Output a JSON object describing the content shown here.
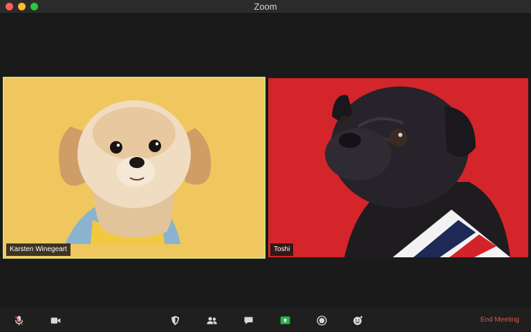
{
  "window": {
    "title": "Zoom"
  },
  "participants": [
    {
      "name": "Karsten Winegeart",
      "active_speaker": true
    },
    {
      "name": "Toshi",
      "active_speaker": false
    }
  ],
  "toolbar": {
    "icons": [
      "microphone-muted-icon",
      "video-camera-icon",
      "security-shield-icon",
      "participants-icon",
      "chat-icon",
      "share-screen-icon",
      "record-icon",
      "reactions-icon"
    ],
    "end_label": "End Meeting"
  },
  "colors": {
    "active_speaker_border": "#cde07a",
    "share_screen": "#2bb24c",
    "end_meeting": "#e5504a",
    "left_background": "#eec45a",
    "right_background": "#d4252a"
  }
}
